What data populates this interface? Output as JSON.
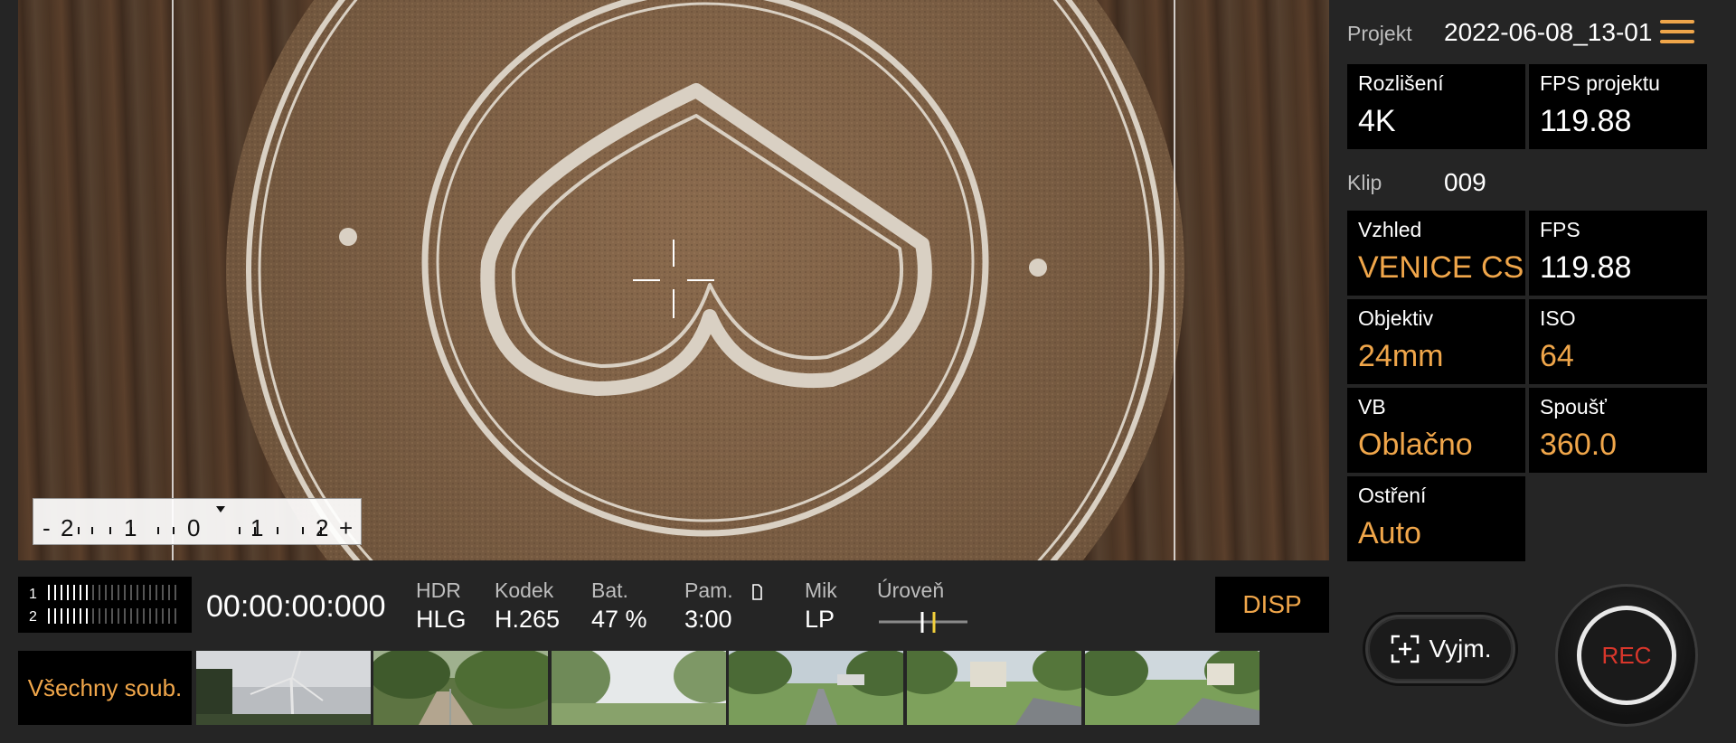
{
  "viewfinder": {
    "ev_scale": {
      "labels": [
        "-",
        "2",
        "1",
        "0",
        "1",
        "2",
        "+"
      ]
    }
  },
  "status": {
    "audio_channels": [
      "1",
      "2"
    ],
    "timecode": "00:00:00:000",
    "items": [
      {
        "label": "HDR",
        "value": "HLG"
      },
      {
        "label": "Kodek",
        "value": "H.265"
      },
      {
        "label": "Bat.",
        "value": "47 %"
      },
      {
        "label": "Pam.",
        "value": "3:00"
      },
      {
        "label": "Mik",
        "value": "LP"
      },
      {
        "label": "Úroveň",
        "value": ""
      }
    ],
    "disp_label": "DISP"
  },
  "files": {
    "all_label": "Všechny soub.",
    "thumbnails": [
      "wind-turbine",
      "forest-path",
      "trees-sky",
      "park-road-1",
      "park-road-2",
      "park-road-3"
    ]
  },
  "panel": {
    "project_label": "Projekt",
    "project_value": "2022-06-08_13-01",
    "clip_label": "Klip",
    "clip_value": "009",
    "cells": [
      {
        "label": "Rozlišení",
        "value": "4K",
        "accent": false
      },
      {
        "label": "FPS projektu",
        "value": "119.88",
        "accent": false
      },
      {
        "label": "Vzhled",
        "value": "VENICE CS",
        "accent": true
      },
      {
        "label": "FPS",
        "value": "119.88",
        "accent": false
      },
      {
        "label": "Objektiv",
        "value": "24mm",
        "accent": true
      },
      {
        "label": "ISO",
        "value": "64",
        "accent": true
      },
      {
        "label": "VB",
        "value": "Oblačno",
        "accent": true
      },
      {
        "label": "Spoušť",
        "value": "360.0",
        "accent": true
      },
      {
        "label": "Ostření",
        "value": "Auto",
        "accent": true
      }
    ],
    "crop_label": "Vyjm.",
    "rec_label": "REC"
  },
  "colors": {
    "accent": "#f0a64a",
    "rec": "#d9362b",
    "background": "#252525"
  }
}
